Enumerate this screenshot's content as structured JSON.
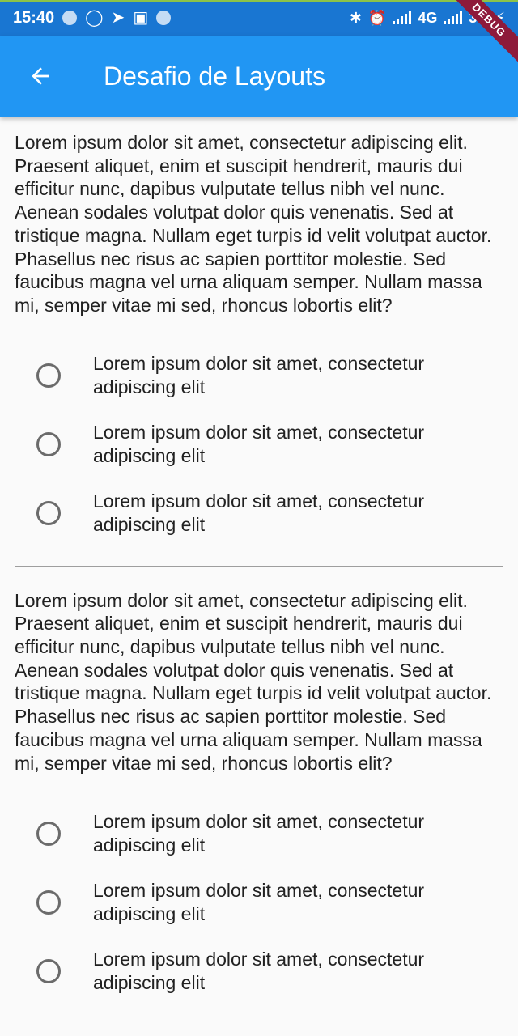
{
  "status_bar": {
    "time": "15:40",
    "network_label": "4G",
    "network2_label": "3G",
    "debug_label": "DEBUG"
  },
  "app_bar": {
    "title": "Desafio de Layouts",
    "back_icon": "arrow-back-icon"
  },
  "sections": [
    {
      "paragraph": "Lorem ipsum dolor sit amet, consectetur adipiscing elit. Praesent aliquet, enim et suscipit hendrerit, mauris dui efficitur nunc, dapibus vulputate tellus nibh vel nunc. Aenean sodales volutpat dolor quis venenatis. Sed at tristique magna. Nullam eget turpis id velit volutpat auctor. Phasellus nec risus ac sapien porttitor molestie. Sed faucibus magna vel urna aliquam semper. Nullam massa mi, semper vitae mi sed, rhoncus lobortis elit?",
      "options": [
        "Lorem ipsum dolor sit amet, consectetur adipiscing elit",
        "Lorem ipsum dolor sit amet, consectetur adipiscing elit",
        "Lorem ipsum dolor sit amet, consectetur adipiscing elit"
      ]
    },
    {
      "paragraph": "Lorem ipsum dolor sit amet, consectetur adipiscing elit. Praesent aliquet, enim et suscipit hendrerit, mauris dui efficitur nunc, dapibus vulputate tellus nibh vel nunc. Aenean sodales volutpat dolor quis venenatis. Sed at tristique magna. Nullam eget turpis id velit volutpat auctor. Phasellus nec risus ac sapien porttitor molestie. Sed faucibus magna vel urna aliquam semper. Nullam massa mi, semper vitae mi sed, rhoncus lobortis elit?",
      "options": [
        "Lorem ipsum dolor sit amet, consectetur adipiscing elit",
        "Lorem ipsum dolor sit amet, consectetur adipiscing elit",
        "Lorem ipsum dolor sit amet, consectetur adipiscing elit"
      ]
    }
  ],
  "colors": {
    "app_bar": "#2196f3",
    "status_bar": "#1976d2",
    "radio_border": "#6b6b6b",
    "text": "#212121"
  }
}
